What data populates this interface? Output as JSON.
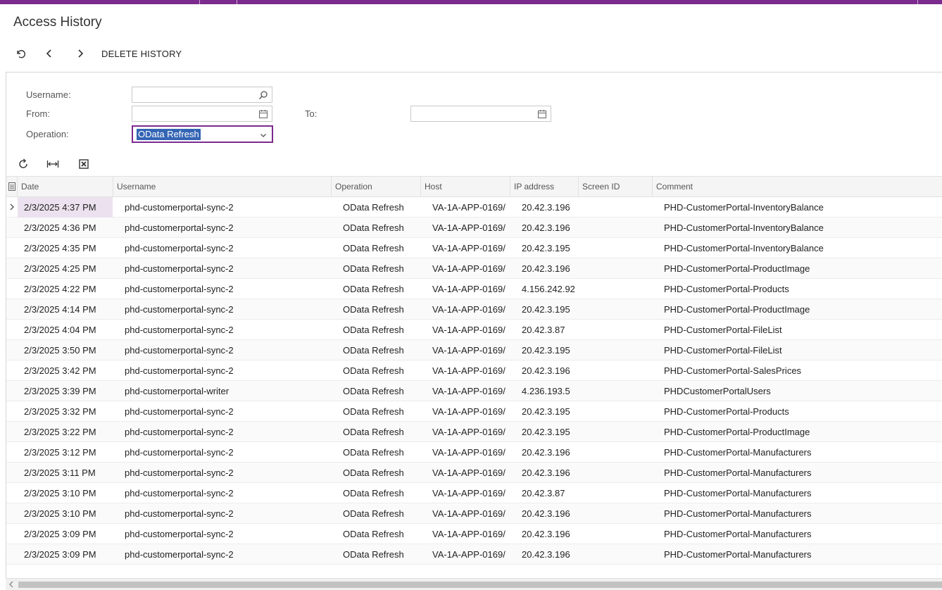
{
  "window": {
    "title": "Access History"
  },
  "toolbar": {
    "undo_icon": "undo-icon",
    "prev_icon": "chevron-left-icon",
    "next_icon": "chevron-right-icon",
    "delete_label": "DELETE HISTORY"
  },
  "filters": {
    "username_label": "Username:",
    "username_value": "",
    "from_label": "From:",
    "from_value": "",
    "to_label": "To:",
    "to_value": "",
    "operation_label": "Operation:",
    "operation_value": "OData Refresh"
  },
  "grid_toolbar": {
    "refresh_icon": "refresh-icon",
    "fit_columns_icon": "fit-columns-icon",
    "export_excel_icon": "excel-export-icon"
  },
  "grid": {
    "columns": [
      "Date",
      "Username",
      "Operation",
      "Host",
      "IP address",
      "Screen ID",
      "Comment"
    ],
    "rows": [
      [
        "2/3/2025 4:37 PM",
        "phd-customerportal-sync-2",
        "OData Refresh",
        "VA-1A-APP-0169/",
        "20.42.3.196",
        "",
        "PHD-CustomerPortal-InventoryBalance"
      ],
      [
        "2/3/2025 4:36 PM",
        "phd-customerportal-sync-2",
        "OData Refresh",
        "VA-1A-APP-0169/",
        "20.42.3.196",
        "",
        "PHD-CustomerPortal-InventoryBalance"
      ],
      [
        "2/3/2025 4:35 PM",
        "phd-customerportal-sync-2",
        "OData Refresh",
        "VA-1A-APP-0169/",
        "20.42.3.195",
        "",
        "PHD-CustomerPortal-InventoryBalance"
      ],
      [
        "2/3/2025 4:25 PM",
        "phd-customerportal-sync-2",
        "OData Refresh",
        "VA-1A-APP-0169/",
        "20.42.3.196",
        "",
        "PHD-CustomerPortal-ProductImage"
      ],
      [
        "2/3/2025 4:22 PM",
        "phd-customerportal-sync-2",
        "OData Refresh",
        "VA-1A-APP-0169/",
        "4.156.242.92",
        "",
        "PHD-CustomerPortal-Products"
      ],
      [
        "2/3/2025 4:14 PM",
        "phd-customerportal-sync-2",
        "OData Refresh",
        "VA-1A-APP-0169/",
        "20.42.3.195",
        "",
        "PHD-CustomerPortal-ProductImage"
      ],
      [
        "2/3/2025 4:04 PM",
        "phd-customerportal-sync-2",
        "OData Refresh",
        "VA-1A-APP-0169/",
        "20.42.3.87",
        "",
        "PHD-CustomerPortal-FileList"
      ],
      [
        "2/3/2025 3:50 PM",
        "phd-customerportal-sync-2",
        "OData Refresh",
        "VA-1A-APP-0169/",
        "20.42.3.195",
        "",
        "PHD-CustomerPortal-FileList"
      ],
      [
        "2/3/2025 3:42 PM",
        "phd-customerportal-sync-2",
        "OData Refresh",
        "VA-1A-APP-0169/",
        "20.42.3.196",
        "",
        "PHD-CustomerPortal-SalesPrices"
      ],
      [
        "2/3/2025 3:39 PM",
        "phd-customerportal-writer",
        "OData Refresh",
        "VA-1A-APP-0169/",
        "4.236.193.5",
        "",
        "PHDCustomerPortalUsers"
      ],
      [
        "2/3/2025 3:32 PM",
        "phd-customerportal-sync-2",
        "OData Refresh",
        "VA-1A-APP-0169/",
        "20.42.3.195",
        "",
        "PHD-CustomerPortal-Products"
      ],
      [
        "2/3/2025 3:22 PM",
        "phd-customerportal-sync-2",
        "OData Refresh",
        "VA-1A-APP-0169/",
        "20.42.3.195",
        "",
        "PHD-CustomerPortal-ProductImage"
      ],
      [
        "2/3/2025 3:12 PM",
        "phd-customerportal-sync-2",
        "OData Refresh",
        "VA-1A-APP-0169/",
        "20.42.3.196",
        "",
        "PHD-CustomerPortal-Manufacturers"
      ],
      [
        "2/3/2025 3:11 PM",
        "phd-customerportal-sync-2",
        "OData Refresh",
        "VA-1A-APP-0169/",
        "20.42.3.196",
        "",
        "PHD-CustomerPortal-Manufacturers"
      ],
      [
        "2/3/2025 3:10 PM",
        "phd-customerportal-sync-2",
        "OData Refresh",
        "VA-1A-APP-0169/",
        "20.42.3.87",
        "",
        "PHD-CustomerPortal-Manufacturers"
      ],
      [
        "2/3/2025 3:10 PM",
        "phd-customerportal-sync-2",
        "OData Refresh",
        "VA-1A-APP-0169/",
        "20.42.3.196",
        "",
        "PHD-CustomerPortal-Manufacturers"
      ],
      [
        "2/3/2025 3:09 PM",
        "phd-customerportal-sync-2",
        "OData Refresh",
        "VA-1A-APP-0169/",
        "20.42.3.196",
        "",
        "PHD-CustomerPortal-Manufacturers"
      ],
      [
        "2/3/2025 3:09 PM",
        "phd-customerportal-sync-2",
        "OData Refresh",
        "VA-1A-APP-0169/",
        "20.42.3.196",
        "",
        "PHD-CustomerPortal-Manufacturers"
      ]
    ],
    "active_row": 0
  },
  "colors": {
    "accent": "#7b2a8e",
    "selection": "#3464b4",
    "active_row_bg": "#ece2ef",
    "header_bg": "#f5f5f5"
  }
}
